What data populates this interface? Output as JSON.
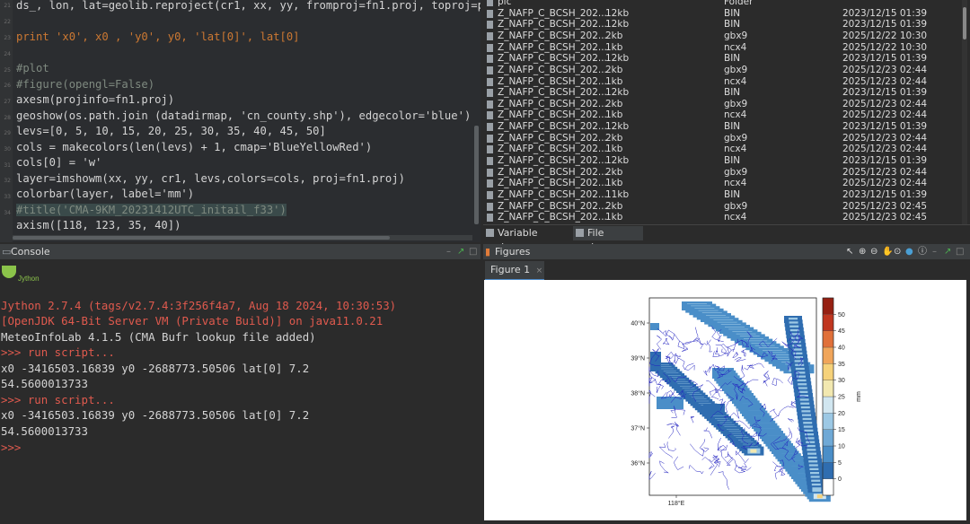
{
  "editor": {
    "line_numbers": [
      "21",
      "22",
      "23",
      "24",
      "25",
      "26",
      "27",
      "28",
      "29",
      "30",
      "31",
      "32",
      "33",
      "34"
    ],
    "lines": [
      "ds_, lon, lat=geolib.reproject(cr1, xx, yy, fromproj=fn1.proj, toproj=pro",
      "",
      "print 'x0', x0 , 'y0', y0, 'lat[0]', lat[0]",
      "",
      "#plot",
      "#figure(opengl=False)",
      "axesm(projinfo=fn1.proj)",
      "geoshow(os.path.join (datadirmap, 'cn_county.shp'), edgecolor='blue')",
      "levs=[0, 5, 10, 15, 20, 25, 30, 35, 40, 45, 50]",
      "cols = makecolors(len(levs) + 1, cmap='BlueYellowRed')",
      "cols[0] = 'w'",
      "layer=imshowm(xx, yy, cr1, levs,colors=cols, proj=fn1.proj)",
      "colorbar(layer, label='mm')",
      "#title('CMA-9KM_20231412UTC_initail_f33')",
      "axism([118, 123, 35, 40])"
    ]
  },
  "explorer": {
    "header": {
      "name": "pic",
      "size": "",
      "type": "Folder",
      "date": ""
    },
    "rows": [
      {
        "name": "Z_NAFP_C_BCSH_202...",
        "size": "12kb",
        "type": "BIN",
        "date": "2023/12/15 01:39"
      },
      {
        "name": "Z_NAFP_C_BCSH_202...",
        "size": "12kb",
        "type": "BIN",
        "date": "2023/12/15 01:39"
      },
      {
        "name": "Z_NAFP_C_BCSH_202...",
        "size": "2kb",
        "type": "gbx9",
        "date": "2025/12/22 10:30"
      },
      {
        "name": "Z_NAFP_C_BCSH_202...",
        "size": "1kb",
        "type": "ncx4",
        "date": "2025/12/22 10:30"
      },
      {
        "name": "Z_NAFP_C_BCSH_202...",
        "size": "12kb",
        "type": "BIN",
        "date": "2023/12/15 01:39"
      },
      {
        "name": "Z_NAFP_C_BCSH_202...",
        "size": "2kb",
        "type": "gbx9",
        "date": "2025/12/23 02:44"
      },
      {
        "name": "Z_NAFP_C_BCSH_202...",
        "size": "1kb",
        "type": "ncx4",
        "date": "2025/12/23 02:44"
      },
      {
        "name": "Z_NAFP_C_BCSH_202...",
        "size": "12kb",
        "type": "BIN",
        "date": "2023/12/15 01:39"
      },
      {
        "name": "Z_NAFP_C_BCSH_202...",
        "size": "2kb",
        "type": "gbx9",
        "date": "2025/12/23 02:44"
      },
      {
        "name": "Z_NAFP_C_BCSH_202...",
        "size": "1kb",
        "type": "ncx4",
        "date": "2025/12/23 02:44"
      },
      {
        "name": "Z_NAFP_C_BCSH_202...",
        "size": "12kb",
        "type": "BIN",
        "date": "2023/12/15 01:39"
      },
      {
        "name": "Z_NAFP_C_BCSH_202...",
        "size": "2kb",
        "type": "gbx9",
        "date": "2025/12/23 02:44"
      },
      {
        "name": "Z_NAFP_C_BCSH_202...",
        "size": "1kb",
        "type": "ncx4",
        "date": "2025/12/23 02:44"
      },
      {
        "name": "Z_NAFP_C_BCSH_202...",
        "size": "12kb",
        "type": "BIN",
        "date": "2023/12/15 01:39"
      },
      {
        "name": "Z_NAFP_C_BCSH_202...",
        "size": "2kb",
        "type": "gbx9",
        "date": "2025/12/23 02:44"
      },
      {
        "name": "Z_NAFP_C_BCSH_202...",
        "size": "1kb",
        "type": "ncx4",
        "date": "2025/12/23 02:44"
      },
      {
        "name": "Z_NAFP_C_BCSH_202...",
        "size": "11kb",
        "type": "BIN",
        "date": "2023/12/15 01:39"
      },
      {
        "name": "Z_NAFP_C_BCSH_202...",
        "size": "2kb",
        "type": "gbx9",
        "date": "2025/12/23 02:45"
      },
      {
        "name": "Z_NAFP_C_BCSH_202...",
        "size": "1kb",
        "type": "ncx4",
        "date": "2025/12/23 02:45"
      }
    ],
    "tabs": [
      "Variable explorer",
      "File explorer"
    ]
  },
  "console": {
    "title": "Console",
    "logo": "Jython",
    "lines": [
      {
        "text": "Jython 2.7.4 (tags/v2.7.4:3f256f4a7, Aug 18 2024, 10:30:53)",
        "cls": "err"
      },
      {
        "text": "[OpenJDK 64-Bit Server VM (Private Build)] on java11.0.21",
        "cls": "err"
      },
      {
        "text": "MeteoInfoLab 4.1.5 (CMA Bufr lookup file added)",
        "cls": ""
      },
      {
        "text": ">>> run script...",
        "cls": "prompt"
      },
      {
        "text": "x0 -3416503.16839 y0 -2688773.50506 lat[0] 7.2",
        "cls": ""
      },
      {
        "text": "54.5600013733",
        "cls": ""
      },
      {
        "text": ">>> run script...",
        "cls": "prompt"
      },
      {
        "text": "x0 -3416503.16839 y0 -2688773.50506 lat[0] 7.2",
        "cls": ""
      },
      {
        "text": "54.5600013733",
        "cls": ""
      },
      {
        "text": ">>>",
        "cls": "prompt"
      }
    ]
  },
  "figures": {
    "title": "Figures",
    "tab": "Figure 1",
    "close": "×"
  },
  "chart_data": {
    "type": "heatmap",
    "title": "",
    "lat_ticks": [
      "40°N",
      "39°N",
      "38°N",
      "37°N",
      "36°N"
    ],
    "lon_ticks": [
      "118°E"
    ],
    "xlim": [
      118,
      123
    ],
    "ylim": [
      35,
      40
    ],
    "colorbar": {
      "label": "mm",
      "levels": [
        0,
        5,
        10,
        15,
        20,
        25,
        30,
        35,
        40,
        45,
        50
      ],
      "colors": [
        "#ffffff",
        "#2f6db0",
        "#4a8ec8",
        "#6fa9d6",
        "#9cc8e4",
        "#d1e6f0",
        "#f2e8b0",
        "#f6d27a",
        "#f0a55a",
        "#e0703a",
        "#c0361f",
        "#962012"
      ]
    }
  },
  "colors": {
    "editor_bg": "#2b2d30",
    "panel_bg": "#2b2b2b",
    "header_bg": "#3c3f41"
  }
}
